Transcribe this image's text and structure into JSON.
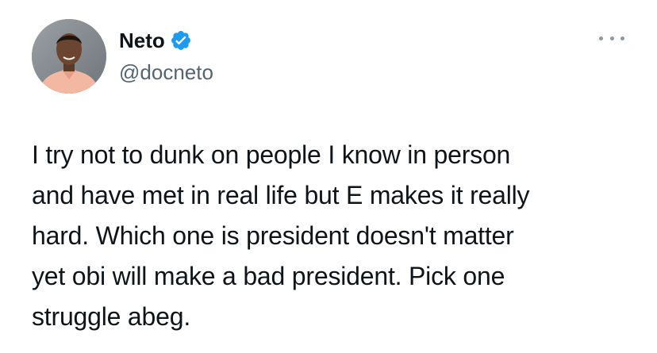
{
  "tweet": {
    "author": {
      "display_name": "Neto",
      "handle": "@docneto",
      "verified": true,
      "verified_color": "#1d9bf0"
    },
    "more_icon": "more-options-icon",
    "text_lines": [
      "I try not to dunk on people I know in person",
      "and have met in real life but E makes it really",
      "hard. Which one is president doesn't matter",
      "yet obi will make a bad president. Pick one",
      "struggle abeg."
    ]
  }
}
